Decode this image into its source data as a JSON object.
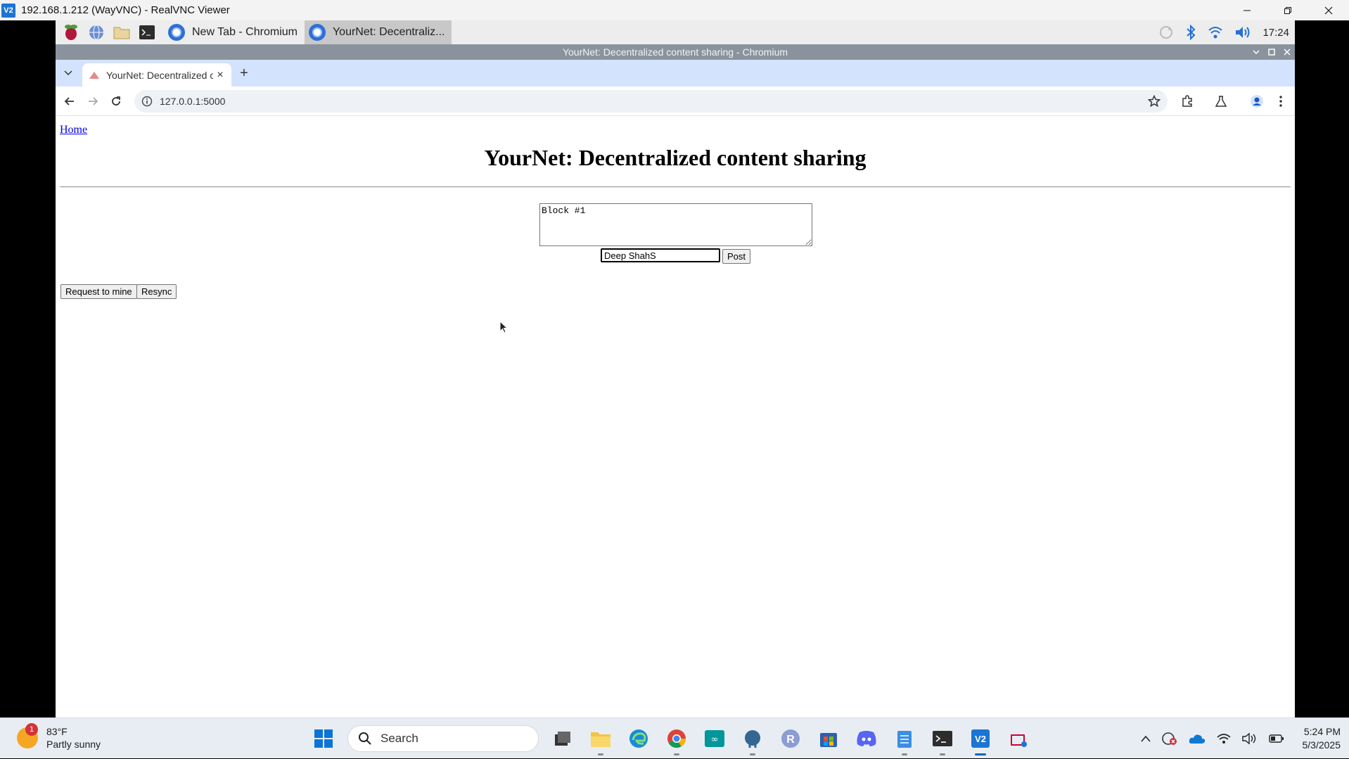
{
  "vnc": {
    "title": "192.168.1.212 (WayVNC) - RealVNC Viewer",
    "logo_text": "V2"
  },
  "pi_panel": {
    "tasks": [
      {
        "label": "New Tab - Chromium"
      },
      {
        "label": "YourNet: Decentraliz..."
      }
    ],
    "clock": "17:24"
  },
  "chromium": {
    "window_title": "YourNet: Decentralized content sharing - Chromium",
    "tab_title": "YourNet: Decentralized c",
    "url": "127.0.0.1:5000"
  },
  "page": {
    "home_link": "Home",
    "heading": "YourNet: Decentralized content sharing",
    "textarea_value": "Block #1",
    "author_value": "Deep ShahS",
    "post_label": "Post",
    "request_label": "Request to mine",
    "resync_label": "Resync"
  },
  "taskbar": {
    "weather_temp": "83°F",
    "weather_desc": "Partly sunny",
    "weather_badge": "1",
    "search_label": "Search",
    "time": "5:24 PM",
    "date": "5/3/2025"
  },
  "colors": {
    "accent": "#0067c0",
    "chrome_tabstrip": "#d3e3fd",
    "chrome_titlebar": "#8a939d",
    "link": "#0000ee"
  }
}
